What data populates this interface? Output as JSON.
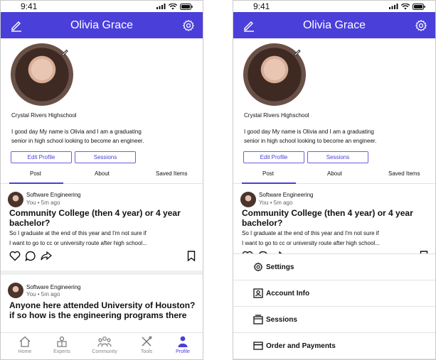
{
  "status": {
    "time": "9:41"
  },
  "header": {
    "title": "Olivia Grace"
  },
  "profile": {
    "school": "Crystal Rivers Highschool",
    "bio_line1": "I good day My name is Olivia and I am a graduating",
    "bio_line2": "senior in high school looking to become an engineer.",
    "edit_label": "Edit Profile",
    "sessions_label": "Sessions"
  },
  "tabs": [
    "Post",
    "About",
    "Saved Items"
  ],
  "posts": [
    {
      "category": "Software Engineering",
      "meta": "You • 5m ago",
      "title_line1": "Community College (then 4 year) or 4 year",
      "title_line2": "bachelor?",
      "body_line1": "So I graduate at the end of this year and I'm not sure if",
      "body_line2": "I want to go to cc or university route after high school..."
    },
    {
      "category": "Software Engineering",
      "meta": "You • 5m ago",
      "title_line1": "Anyone here attended University of Houston?",
      "title_line2": "if so how is the engineering programs there"
    }
  ],
  "nav": [
    {
      "label": "Home",
      "icon": "home-icon"
    },
    {
      "label": "Experts",
      "icon": "experts-icon"
    },
    {
      "label": "Community",
      "icon": "community-icon"
    },
    {
      "label": "Tools",
      "icon": "tools-icon"
    },
    {
      "label": "Profile",
      "icon": "profile-icon"
    }
  ],
  "menu": [
    {
      "label": "Settings",
      "icon": "gear-icon"
    },
    {
      "label": "Account Info",
      "icon": "account-card-icon"
    },
    {
      "label": "Sessions",
      "icon": "sessions-icon"
    },
    {
      "label": "Order and Payments",
      "icon": "card-icon"
    }
  ],
  "colors": {
    "accent": "#4a3fd9",
    "divider": "#efefef"
  }
}
